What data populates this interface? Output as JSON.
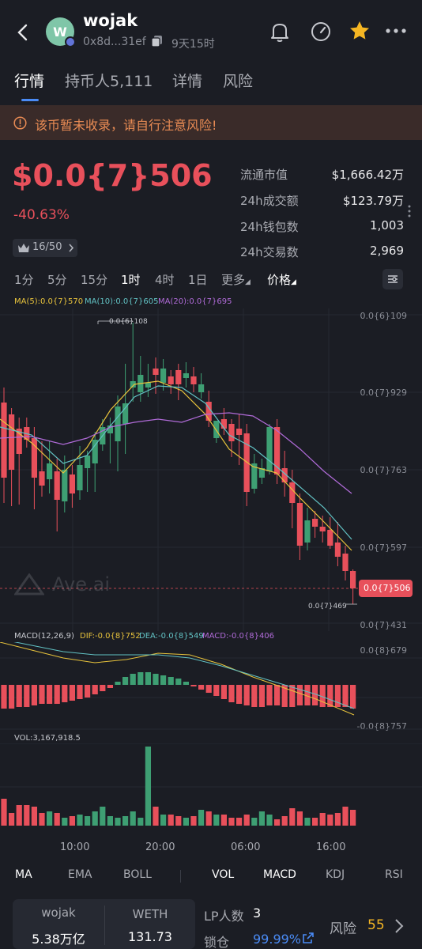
{
  "header": {
    "token_name": "wojak",
    "avatar_letter": "W",
    "address": "0x8d...31ef",
    "age": "9天15时"
  },
  "tabs": [
    {
      "label": "行情"
    },
    {
      "label": "持币人5,111"
    },
    {
      "label": "详情"
    },
    {
      "label": "风险"
    }
  ],
  "warning": "该币暂未收录，请自行注意风险!",
  "price": {
    "value": "$0.0{7}506",
    "change": "-40.63%",
    "rank": "16/50"
  },
  "stats": [
    {
      "label": "流通市值",
      "value": "$1,666.42万"
    },
    {
      "label": "24h成交额",
      "value": "$123.79万"
    },
    {
      "label": "24h钱包数",
      "value": "1,003"
    },
    {
      "label": "24h交易数",
      "value": "2,969"
    }
  ],
  "intervals": [
    "1分",
    "5分",
    "15分",
    "1时",
    "4时",
    "1日",
    "更多",
    "价格"
  ],
  "selected_interval": "1时",
  "ma_legend": {
    "ma5": "MA(5):0.0{7}570",
    "ma10": "MA(10):0.0{7}605",
    "ma20": "MA(20):0.0{7}695"
  },
  "price_axis": [
    "0.0{6}109",
    "0.0{7}929",
    "0.0{7}763",
    "0.0{7}597",
    "0.0{7}431"
  ],
  "high_marker": "0.0{6}108",
  "low_marker": "0.0{7}469",
  "current_tag": "0.0{7}506",
  "watermark": "Ave.ai",
  "macd_legend": {
    "title": "MACD(12,26,9)",
    "dif": "DIF:-0.0{8}752",
    "dea": "DEA:-0.0{8}549",
    "macd": "MACD:-0.0{8}406"
  },
  "macd_axis": [
    "0.0{8}679",
    "-0.0{8}757"
  ],
  "vol_legend": "VOL:3,167,918.5",
  "time_axis": [
    "10:00",
    "20:00",
    "06:00",
    "16:00"
  ],
  "indicators": [
    "MA",
    "EMA",
    "BOLL",
    "VOL",
    "MACD",
    "KDJ",
    "RSI"
  ],
  "active_indicators": [
    "MA",
    "VOL",
    "MACD"
  ],
  "bottom": {
    "token_a_name": "wojak",
    "token_a_amount": "5.38万亿",
    "token_b_name": "WETH",
    "token_b_amount": "131.73",
    "lp_label": "LP人数",
    "lp_count": "3",
    "lock_label": "锁仓",
    "lock_value": "99.99%",
    "risk_label": "风险",
    "risk_value": "55"
  },
  "colors": {
    "up": "#3e9f73",
    "down": "#e8505b",
    "ma5": "#e8c33c",
    "ma10": "#62c2c4",
    "ma20": "#b06bd8",
    "accent": "#4a8bf5",
    "star": "#f5b623"
  }
}
